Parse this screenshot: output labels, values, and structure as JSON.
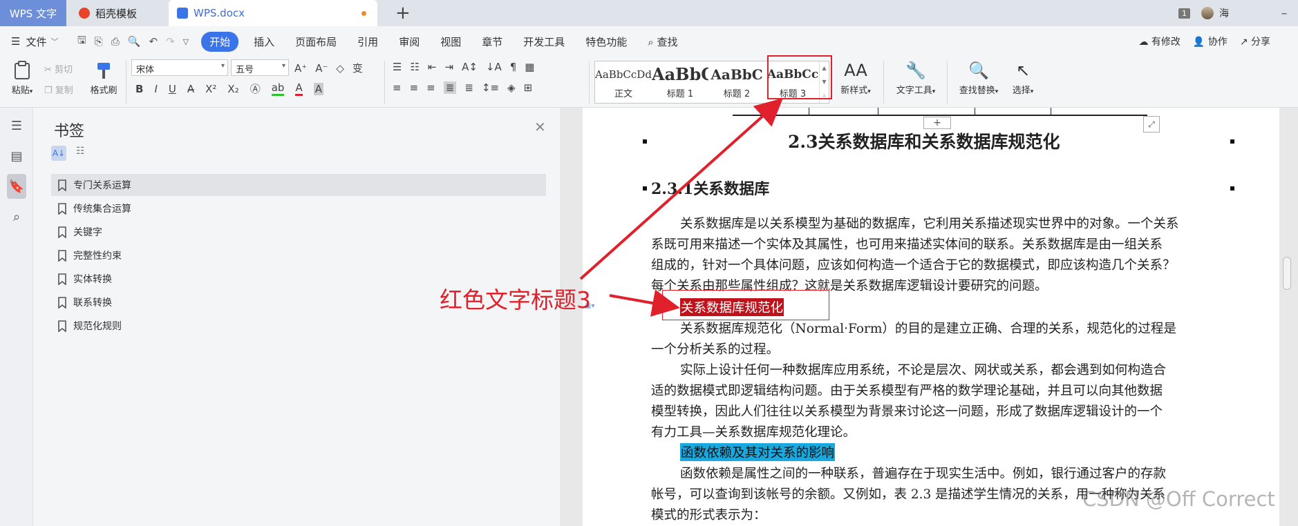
{
  "tabs": {
    "app": "WPS 文字",
    "template": "稻壳模板",
    "document": "WPS.docx"
  },
  "titlebar": {
    "badge": "1",
    "user": "海"
  },
  "menu": {
    "file": "文件",
    "items": [
      "开始",
      "插入",
      "页面布局",
      "引用",
      "审阅",
      "视图",
      "章节",
      "开发工具",
      "特色功能"
    ],
    "search": "查找",
    "right": [
      "有修改",
      "协作",
      "分享"
    ]
  },
  "ribbon": {
    "paste": "粘贴",
    "cut": "剪切",
    "copy": "复制",
    "format_painter": "格式刷",
    "font": "宋体",
    "size": "五号",
    "styles": [
      {
        "preview": "AaBbCcDd",
        "label": "正文"
      },
      {
        "preview": "AaBbC",
        "label": "标题 1"
      },
      {
        "preview": "AaBbC",
        "label": "标题 2"
      },
      {
        "preview": "AaBbCc",
        "label": "标题 3"
      }
    ],
    "new_style": "新样式",
    "text_tools": "文字工具",
    "find_replace": "查找替换",
    "select": "选择"
  },
  "bookmarks": {
    "title": "书签",
    "items": [
      "专门关系运算",
      "传统集合运算",
      "关键字",
      "完整性约束",
      "实体转换",
      "联系转换",
      "规范化规则"
    ]
  },
  "doc": {
    "h2": "2.3关系数据库和关系数据库规范化",
    "h3": "2.3.1关系数据库",
    "lines1": [
      "关系数据库是以关系模型为基础的数据库，它利用关系描述现实世界中的对象。一个关系",
      "系既可用来描述一个实体及其属性，也可用来描述实体间的联系。关系数据库是由一组关系",
      "组成的，针对一个具体问题，应该如何构造一个适合于它的数据模式，即应该构造几个关系？",
      "每个关系由那些属性组成？这就是关系数据库逻辑设计要研究的问题。"
    ],
    "red_heading": "关系数据库规范化",
    "lines2": [
      "关系数据库规范化（Normal·Form）的目的是建立正确、合理的关系，规范化的过程是",
      "一个分析关系的过程。",
      "实际上设计任何一种数据库应用系统，不论是层次、网状或关系，都会遇到如何构造合",
      "适的数据模式即逻辑结构问题。由于关系模型有严格的数学理论基础，并且可以向其他数据",
      "模型转换，因此人们往往以关系模型为背景来讨论这一问题，形成了数据库逻辑设计的一个",
      "有力工具—关系数据库规范化理论。"
    ],
    "blue_heading": "函数依赖及其对关系的影响",
    "lines3": [
      "函数依赖是属性之间的一种联系，普遍存在于现实生活中。例如，银行通过客户的存款",
      "帐号，可以查询到该帐号的余额。又例如，表 2.3 是描述学生情况的关系，用一种称为关系",
      "模式的形式表示为："
    ]
  },
  "annotation": "红色文字标题3",
  "watermark": "CSDN @Off Correct",
  "colors": {
    "accent": "#3b73e8",
    "annotation_red": "#e0212c",
    "heading3_bg": "#c0121a",
    "heading_blue_bg": "#17a9df"
  }
}
